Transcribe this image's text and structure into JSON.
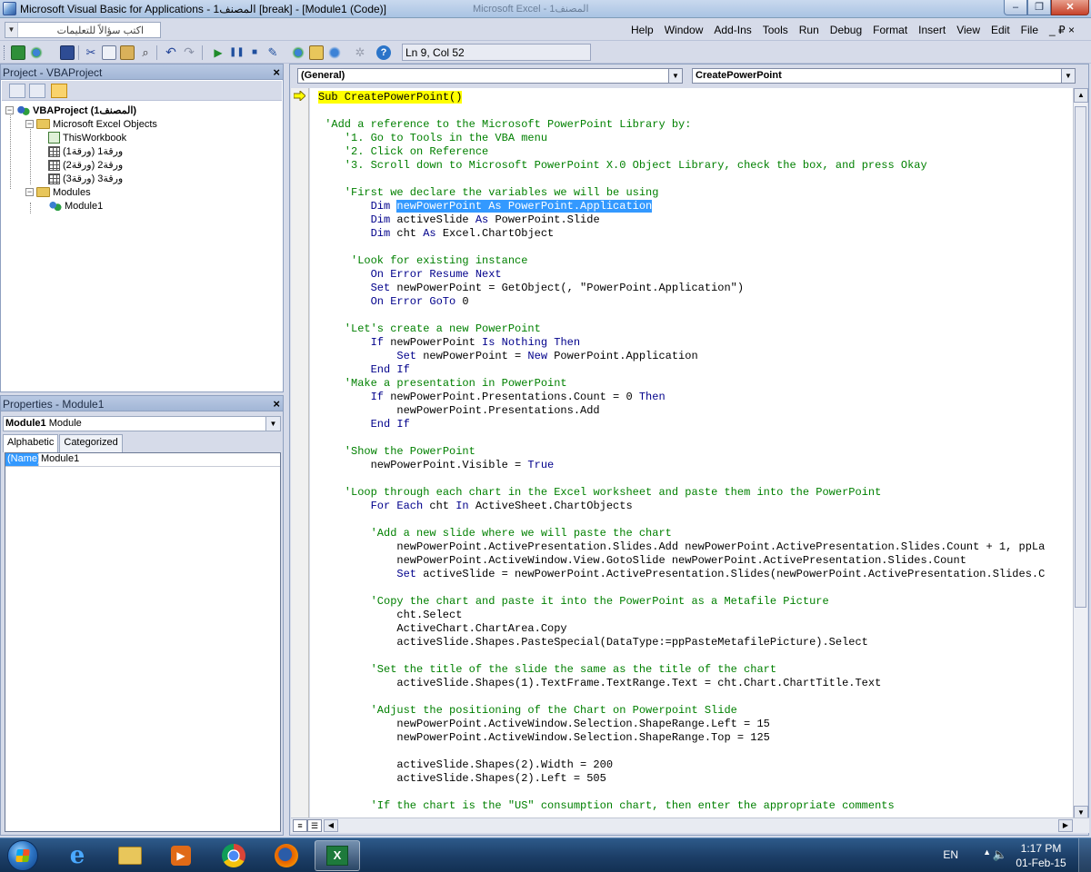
{
  "window": {
    "title": "Microsoft Visual Basic for Applications - المصنف1 [break] - [Module1 (Code)]",
    "background_title": "Microsoft Excel - المصنف1",
    "minimize": "‒",
    "maximize": "❐",
    "close": "✕"
  },
  "menubar": {
    "ask_placeholder": "اكتب سؤالاً للتعليمات",
    "items": [
      "Help",
      "Window",
      "Add-Ins",
      "Tools",
      "Run",
      "Debug",
      "Format",
      "Insert",
      "View",
      "Edit",
      "File"
    ],
    "mdi_controls": "_ ₽ ×"
  },
  "toolbar": {
    "status": "Ln 9, Col 52",
    "colors": {
      "run": "#1f8c2b",
      "pause": "#1f4f9e",
      "stop": "#1f4f9e",
      "help": "#2a74c9"
    }
  },
  "project": {
    "title": "Project - VBAProject",
    "tree": {
      "project": "VBAProject (المصنف1)",
      "excel_objects": "Microsoft Excel Objects",
      "this_workbook": "ThisWorkbook",
      "sheets": [
        "ورقة1 (ورقة1)",
        "ورقة2 (ورقة2)",
        "ورقة3 (ورقة3)"
      ],
      "modules_folder": "Modules",
      "module": "Module1"
    }
  },
  "properties": {
    "title": "Properties - Module1",
    "object_name": "Module1",
    "object_type": "Module",
    "tabs": [
      "Alphabetic",
      "Categorized"
    ],
    "rows": [
      {
        "name": "(Name)",
        "value": "Module1"
      }
    ]
  },
  "code": {
    "object_combo": "(General)",
    "proc_combo": "CreatePowerPoint",
    "lines": [
      {
        "indent": 0,
        "segs": [
          {
            "c": "exec",
            "t": "Sub CreatePowerPoint()"
          }
        ]
      },
      {
        "indent": 0,
        "segs": []
      },
      {
        "indent": 1,
        "segs": [
          {
            "c": "cm",
            "t": "'Add a reference to the Microsoft PowerPoint Library by:"
          }
        ]
      },
      {
        "indent": 4,
        "segs": [
          {
            "c": "cm",
            "t": "'1. Go to Tools in the VBA menu"
          }
        ]
      },
      {
        "indent": 4,
        "segs": [
          {
            "c": "cm",
            "t": "'2. Click on Reference"
          }
        ]
      },
      {
        "indent": 4,
        "segs": [
          {
            "c": "cm",
            "t": "'3. Scroll down to Microsoft PowerPoint X.0 Object Library, check the box, and press Okay"
          }
        ]
      },
      {
        "indent": 0,
        "segs": []
      },
      {
        "indent": 4,
        "segs": [
          {
            "c": "cm",
            "t": "'First we declare the variables we will be using"
          }
        ]
      },
      {
        "indent": 8,
        "segs": [
          {
            "c": "kw",
            "t": "Dim "
          },
          {
            "c": "sel",
            "t": "newPowerPoint As PowerPoint.Application"
          }
        ]
      },
      {
        "indent": 8,
        "segs": [
          {
            "c": "kw",
            "t": "Dim "
          },
          {
            "c": "tx",
            "t": "activeSlide "
          },
          {
            "c": "kw",
            "t": "As "
          },
          {
            "c": "tx",
            "t": "PowerPoint.Slide"
          }
        ]
      },
      {
        "indent": 8,
        "segs": [
          {
            "c": "kw",
            "t": "Dim "
          },
          {
            "c": "tx",
            "t": "cht "
          },
          {
            "c": "kw",
            "t": "As "
          },
          {
            "c": "tx",
            "t": "Excel.ChartObject"
          }
        ]
      },
      {
        "indent": 0,
        "segs": []
      },
      {
        "indent": 5,
        "segs": [
          {
            "c": "cm",
            "t": "'Look for existing instance"
          }
        ]
      },
      {
        "indent": 8,
        "segs": [
          {
            "c": "kw",
            "t": "On Error Resume Next"
          }
        ]
      },
      {
        "indent": 8,
        "segs": [
          {
            "c": "kw",
            "t": "Set "
          },
          {
            "c": "tx",
            "t": "newPowerPoint = GetObject(, \"PowerPoint.Application\")"
          }
        ]
      },
      {
        "indent": 8,
        "segs": [
          {
            "c": "kw",
            "t": "On Error GoTo "
          },
          {
            "c": "tx",
            "t": "0"
          }
        ]
      },
      {
        "indent": 0,
        "segs": []
      },
      {
        "indent": 4,
        "segs": [
          {
            "c": "cm",
            "t": "'Let's create a new PowerPoint"
          }
        ]
      },
      {
        "indent": 8,
        "segs": [
          {
            "c": "kw",
            "t": "If "
          },
          {
            "c": "tx",
            "t": "newPowerPoint "
          },
          {
            "c": "kw",
            "t": "Is Nothing Then"
          }
        ]
      },
      {
        "indent": 12,
        "segs": [
          {
            "c": "kw",
            "t": "Set "
          },
          {
            "c": "tx",
            "t": "newPowerPoint = "
          },
          {
            "c": "kw",
            "t": "New "
          },
          {
            "c": "tx",
            "t": "PowerPoint.Application"
          }
        ]
      },
      {
        "indent": 8,
        "segs": [
          {
            "c": "kw",
            "t": "End If"
          }
        ]
      },
      {
        "indent": 4,
        "segs": [
          {
            "c": "cm",
            "t": "'Make a presentation in PowerPoint"
          }
        ]
      },
      {
        "indent": 8,
        "segs": [
          {
            "c": "kw",
            "t": "If "
          },
          {
            "c": "tx",
            "t": "newPowerPoint.Presentations.Count = 0 "
          },
          {
            "c": "kw",
            "t": "Then"
          }
        ]
      },
      {
        "indent": 12,
        "segs": [
          {
            "c": "tx",
            "t": "newPowerPoint.Presentations.Add"
          }
        ]
      },
      {
        "indent": 8,
        "segs": [
          {
            "c": "kw",
            "t": "End If"
          }
        ]
      },
      {
        "indent": 0,
        "segs": []
      },
      {
        "indent": 4,
        "segs": [
          {
            "c": "cm",
            "t": "'Show the PowerPoint"
          }
        ]
      },
      {
        "indent": 8,
        "segs": [
          {
            "c": "tx",
            "t": "newPowerPoint.Visible = "
          },
          {
            "c": "kw",
            "t": "True"
          }
        ]
      },
      {
        "indent": 0,
        "segs": []
      },
      {
        "indent": 4,
        "segs": [
          {
            "c": "cm",
            "t": "'Loop through each chart in the Excel worksheet and paste them into the PowerPoint"
          }
        ]
      },
      {
        "indent": 8,
        "segs": [
          {
            "c": "kw",
            "t": "For Each "
          },
          {
            "c": "tx",
            "t": "cht "
          },
          {
            "c": "kw",
            "t": "In "
          },
          {
            "c": "tx",
            "t": "ActiveSheet.ChartObjects"
          }
        ]
      },
      {
        "indent": 0,
        "segs": []
      },
      {
        "indent": 8,
        "segs": [
          {
            "c": "cm",
            "t": "'Add a new slide where we will paste the chart"
          }
        ]
      },
      {
        "indent": 12,
        "segs": [
          {
            "c": "tx",
            "t": "newPowerPoint.ActivePresentation.Slides.Add newPowerPoint.ActivePresentation.Slides.Count + 1, ppLa"
          }
        ]
      },
      {
        "indent": 12,
        "segs": [
          {
            "c": "tx",
            "t": "newPowerPoint.ActiveWindow.View.GotoSlide newPowerPoint.ActivePresentation.Slides.Count"
          }
        ]
      },
      {
        "indent": 12,
        "segs": [
          {
            "c": "kw",
            "t": "Set "
          },
          {
            "c": "tx",
            "t": "activeSlide = newPowerPoint.ActivePresentation.Slides(newPowerPoint.ActivePresentation.Slides.C"
          }
        ]
      },
      {
        "indent": 0,
        "segs": []
      },
      {
        "indent": 8,
        "segs": [
          {
            "c": "cm",
            "t": "'Copy the chart and paste it into the PowerPoint as a Metafile Picture"
          }
        ]
      },
      {
        "indent": 12,
        "segs": [
          {
            "c": "tx",
            "t": "cht.Select"
          }
        ]
      },
      {
        "indent": 12,
        "segs": [
          {
            "c": "tx",
            "t": "ActiveChart.ChartArea.Copy"
          }
        ]
      },
      {
        "indent": 12,
        "segs": [
          {
            "c": "tx",
            "t": "activeSlide.Shapes.PasteSpecial(DataType:=ppPasteMetafilePicture).Select"
          }
        ]
      },
      {
        "indent": 0,
        "segs": []
      },
      {
        "indent": 8,
        "segs": [
          {
            "c": "cm",
            "t": "'Set the title of the slide the same as the title of the chart"
          }
        ]
      },
      {
        "indent": 12,
        "segs": [
          {
            "c": "tx",
            "t": "activeSlide.Shapes(1).TextFrame.TextRange.Text = cht.Chart.ChartTitle.Text"
          }
        ]
      },
      {
        "indent": 0,
        "segs": []
      },
      {
        "indent": 8,
        "segs": [
          {
            "c": "cm",
            "t": "'Adjust the positioning of the Chart on Powerpoint Slide"
          }
        ]
      },
      {
        "indent": 12,
        "segs": [
          {
            "c": "tx",
            "t": "newPowerPoint.ActiveWindow.Selection.ShapeRange.Left = 15"
          }
        ]
      },
      {
        "indent": 12,
        "segs": [
          {
            "c": "tx",
            "t": "newPowerPoint.ActiveWindow.Selection.ShapeRange.Top = 125"
          }
        ]
      },
      {
        "indent": 0,
        "segs": []
      },
      {
        "indent": 12,
        "segs": [
          {
            "c": "tx",
            "t": "activeSlide.Shapes(2).Width = 200"
          }
        ]
      },
      {
        "indent": 12,
        "segs": [
          {
            "c": "tx",
            "t": "activeSlide.Shapes(2).Left = 505"
          }
        ]
      },
      {
        "indent": 0,
        "segs": []
      },
      {
        "indent": 8,
        "segs": [
          {
            "c": "cm",
            "t": "'If the chart is the \"US\" consumption chart, then enter the appropriate comments"
          }
        ]
      }
    ]
  },
  "taskbar": {
    "apps": [
      "start-button",
      "internet-explorer",
      "file-explorer",
      "media-player",
      "chrome",
      "firefox",
      "excel"
    ],
    "language": "EN",
    "time": "1:17 PM",
    "date": "01-Feb-15"
  }
}
